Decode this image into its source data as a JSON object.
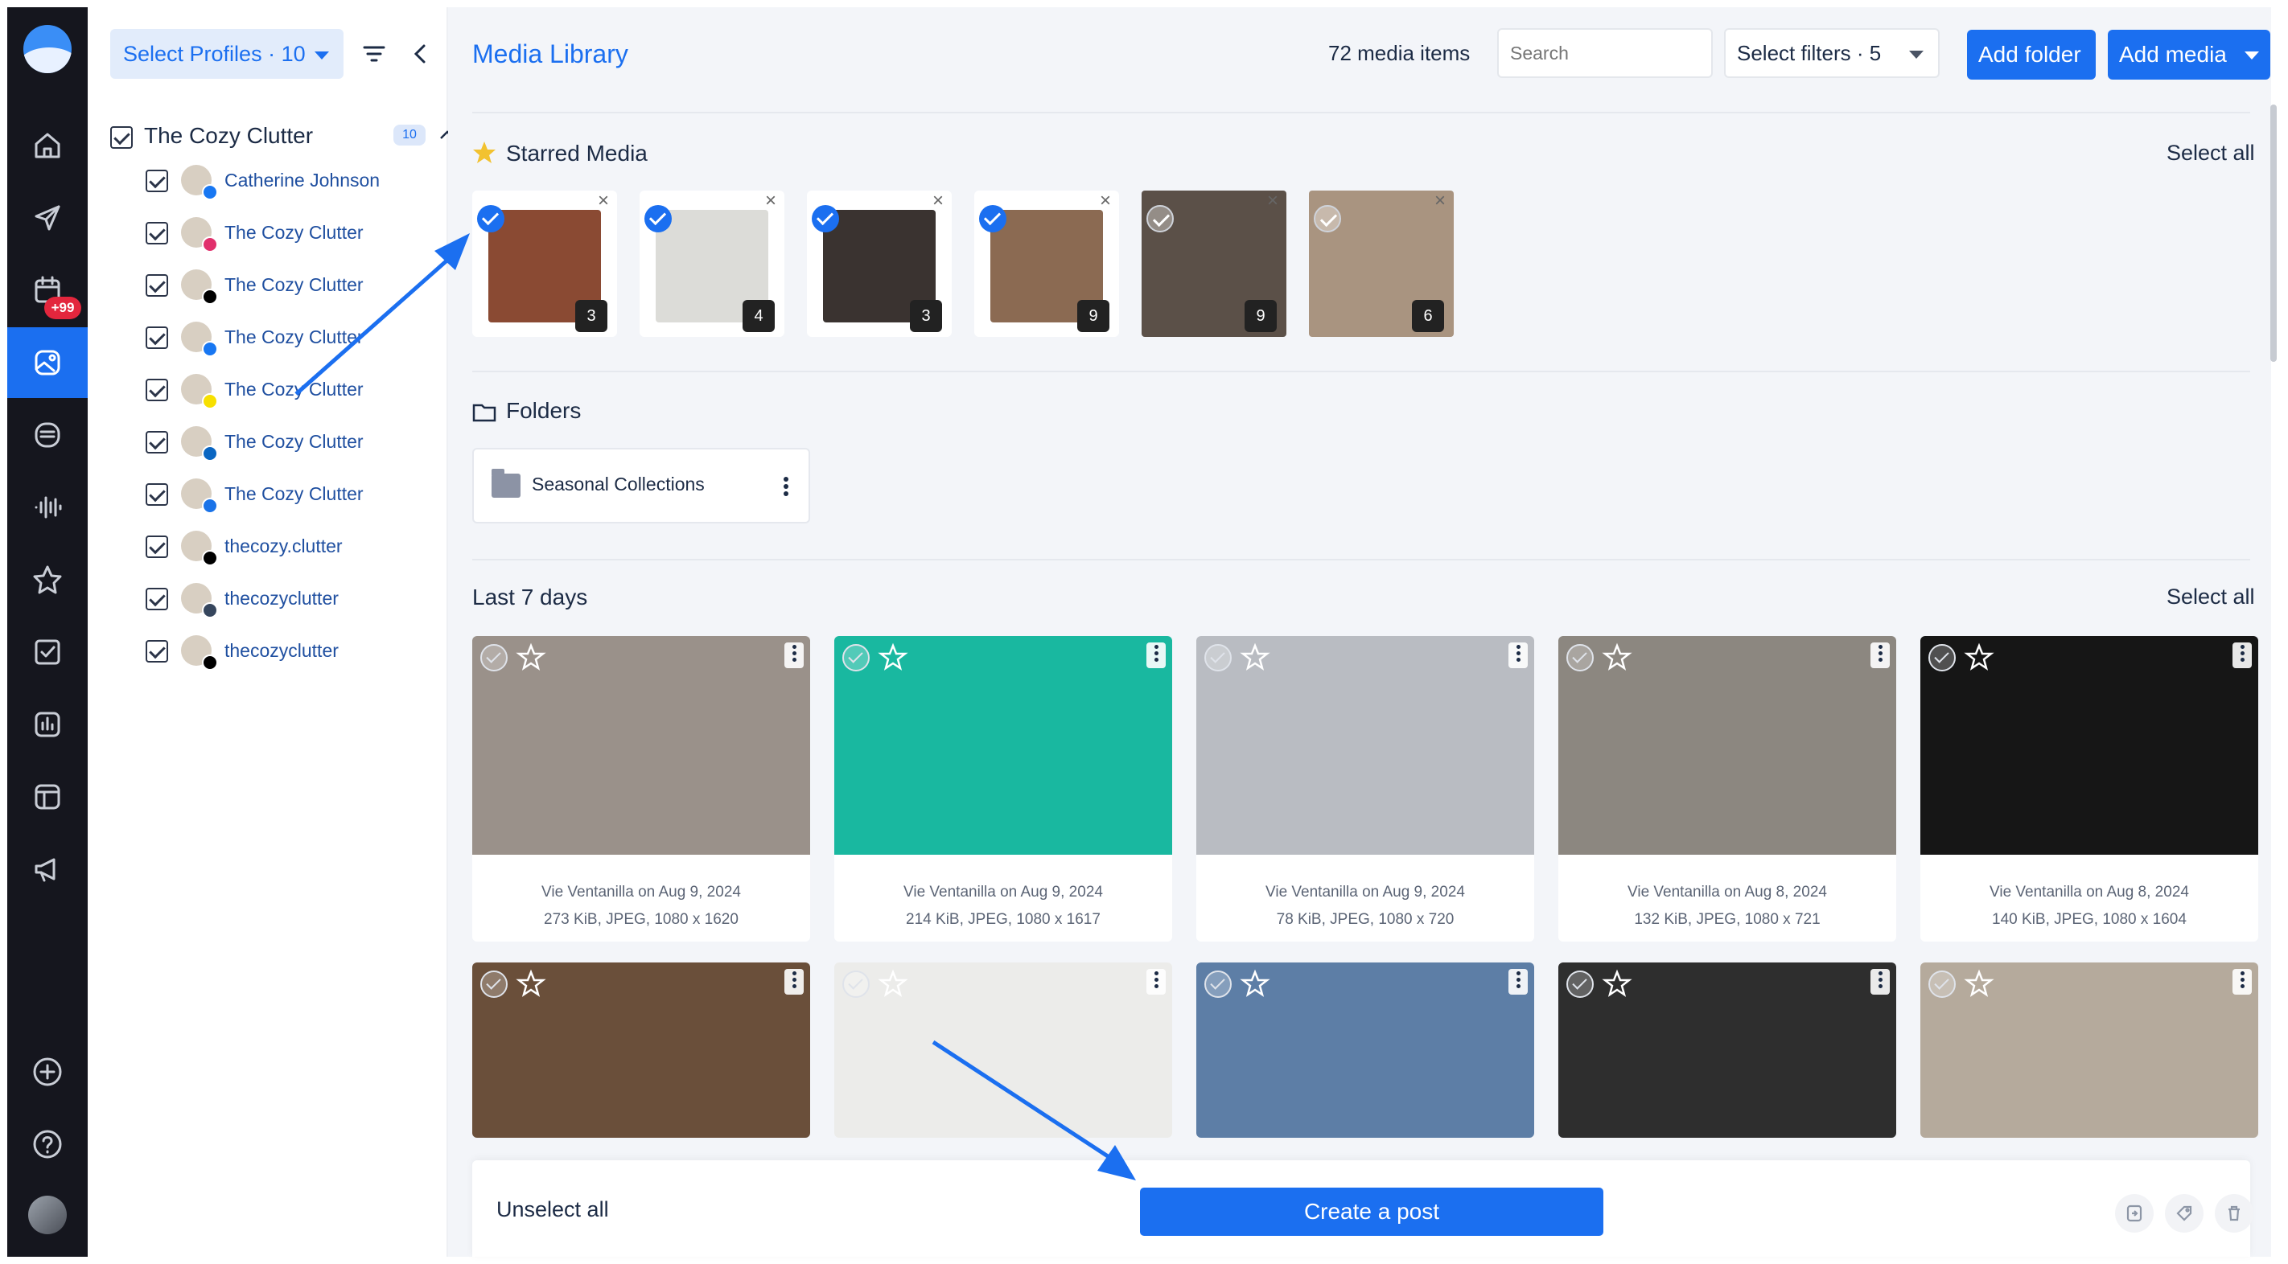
{
  "rail": {
    "badge": "+99",
    "items": [
      "home-icon",
      "send-icon",
      "calendar-icon",
      "media-icon",
      "inbox-icon",
      "listening-icon",
      "star-icon",
      "tasks-icon",
      "analytics-icon",
      "layout-icon",
      "megaphone-icon"
    ]
  },
  "profiles": {
    "select_label": "Select Profiles · 10",
    "group": {
      "name": "The Cozy Clutter",
      "count": "10"
    },
    "items": [
      {
        "name": "Catherine Johnson",
        "network": "facebook",
        "color": "#1877f2"
      },
      {
        "name": "The Cozy Clutter",
        "network": "instagram",
        "color": "#e1306c"
      },
      {
        "name": "The Cozy Clutter",
        "network": "x",
        "color": "#000000"
      },
      {
        "name": "The Cozy Clutter",
        "network": "facebook",
        "color": "#1877f2"
      },
      {
        "name": "The Cozy Clutter",
        "network": "snapchat",
        "color": "#f7e000"
      },
      {
        "name": "The Cozy Clutter",
        "network": "linkedin",
        "color": "#0a66c2"
      },
      {
        "name": "The Cozy Clutter",
        "network": "google-business",
        "color": "#1a73e8"
      },
      {
        "name": "thecozy.clutter",
        "network": "threads",
        "color": "#000000"
      },
      {
        "name": "thecozyclutter",
        "network": "tumblr",
        "color": "#36465d"
      },
      {
        "name": "thecozyclutter",
        "network": "tiktok",
        "color": "#000000"
      }
    ]
  },
  "header": {
    "title": "Media Library",
    "count": "72 media items",
    "search_placeholder": "Search",
    "filters_label": "Select filters · 5",
    "add_folder": "Add folder",
    "add_media": "Add media"
  },
  "starred": {
    "title": "Starred Media",
    "select_all": "Select all",
    "items": [
      {
        "count": "3",
        "selected": true,
        "color": "#8a4a33"
      },
      {
        "count": "4",
        "selected": true,
        "color": "#dcdcd8"
      },
      {
        "count": "3",
        "selected": true,
        "color": "#3a3330"
      },
      {
        "count": "9",
        "selected": true,
        "color": "#8b6a52"
      },
      {
        "count": "9",
        "selected": false,
        "color": "#5b5048"
      },
      {
        "count": "6",
        "selected": false,
        "color": "#a99480"
      }
    ]
  },
  "folders": {
    "title": "Folders",
    "items": [
      {
        "name": "Seasonal Collections"
      }
    ]
  },
  "recent": {
    "title": "Last 7 days",
    "select_all": "Select all",
    "items": [
      {
        "author": "Vie Ventanilla on Aug 9, 2024",
        "info": "273 KiB, JPEG, 1080 x 1620",
        "color": "#9a918a"
      },
      {
        "author": "Vie Ventanilla on Aug 9, 2024",
        "info": "214 KiB, JPEG, 1080 x 1617",
        "color": "#19b8a0"
      },
      {
        "author": "Vie Ventanilla on Aug 9, 2024",
        "info": "78 KiB, JPEG, 1080 x 720",
        "color": "#b9bcc2"
      },
      {
        "author": "Vie Ventanilla on Aug 8, 2024",
        "info": "132 KiB, JPEG, 1080 x 721",
        "color": "#8c8780"
      },
      {
        "author": "Vie Ventanilla on Aug 8, 2024",
        "info": "140 KiB, JPEG, 1080 x 1604",
        "color": "#161616"
      },
      {
        "color": "#6a4f3a"
      },
      {
        "color": "#ececea"
      },
      {
        "color": "#5d7ea6"
      },
      {
        "color": "#2e2e2e"
      },
      {
        "color": "#b5aa9c"
      }
    ]
  },
  "actions": {
    "unselect_all": "Unselect all",
    "create_post": "Create a post"
  }
}
